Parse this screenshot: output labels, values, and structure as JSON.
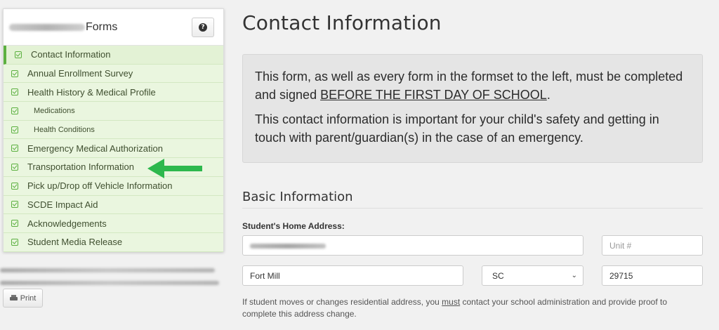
{
  "sidebar": {
    "title": "Forms",
    "help_icon": "question-icon",
    "help_glyph": "?",
    "items": [
      {
        "label": "Contact Information",
        "active": true
      },
      {
        "label": "Annual Enrollment Survey"
      },
      {
        "label": "Health History & Medical Profile"
      },
      {
        "label": "Medications",
        "sub": true
      },
      {
        "label": "Health Conditions",
        "sub": true
      },
      {
        "label": "Emergency Medical Authorization"
      },
      {
        "label": "Transportation Information"
      },
      {
        "label": "Pick up/Drop off Vehicle Information"
      },
      {
        "label": "SCDE Impact Aid"
      },
      {
        "label": "Acknowledgements"
      },
      {
        "label": "Student Media Release"
      }
    ],
    "check_icon": "check-square-icon",
    "arrow_color": "#2db84d",
    "print_label": "Print",
    "print_icon": "printer-icon"
  },
  "main": {
    "title": "Contact Information",
    "notice": {
      "p1_before": "This form, as well as every form in the formset to the left, must be completed and signed ",
      "p1_underline": "BEFORE THE FIRST DAY OF SCHOOL",
      "p1_after": ".",
      "p2": "This contact information is important for your child's safety and getting in touch with parent/guardian(s) in the case of an emergency."
    },
    "section_title": "Basic Information",
    "address_label": "Student's Home Address:",
    "unit_placeholder": "Unit #",
    "city_value": "Fort Mill",
    "state_value": "SC",
    "zip_value": "29715",
    "help_before": "If student moves or changes residential address, you ",
    "help_underline": "must",
    "help_after": " contact your school administration and provide proof to complete this address change."
  },
  "colors": {
    "item_bg": "#eaf6df",
    "check": "#5cb040",
    "notice_bg": "#e5e5e5"
  }
}
